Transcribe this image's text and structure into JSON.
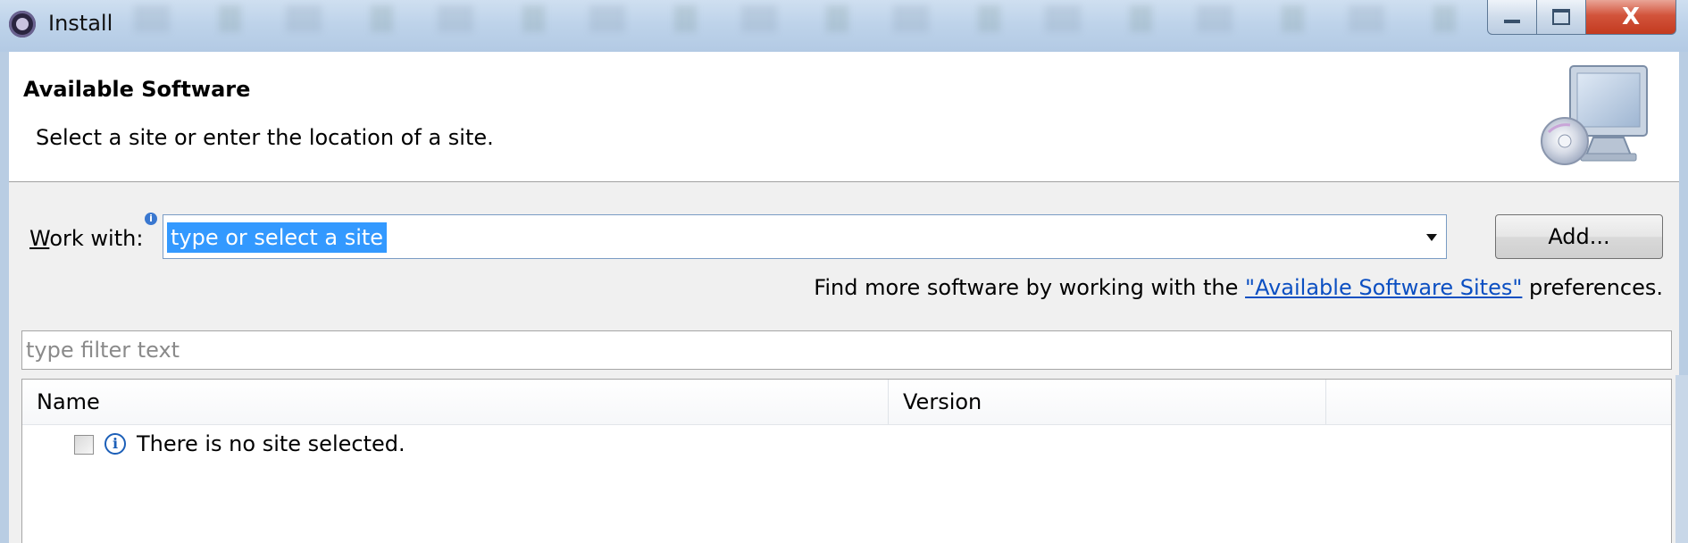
{
  "window": {
    "title": "Install",
    "close_glyph": "X"
  },
  "banner": {
    "title": "Available Software",
    "description": "Select a site or enter the location of a site.",
    "image_icon": "computer-with-cd-icon"
  },
  "work_with": {
    "label": "Work with:",
    "mnemonic": "W",
    "label_rest": "ork with:",
    "value": "type or select a site",
    "add_button_label": "Add...",
    "info_glyph": "i"
  },
  "more_software": {
    "prefix": "Find more software by working with the ",
    "link": "\"Available Software Sites\"",
    "suffix": " preferences."
  },
  "filter": {
    "placeholder": "type filter text"
  },
  "table": {
    "columns": [
      "Name",
      "Version",
      ""
    ],
    "rows": [
      {
        "checked": false,
        "icon": "info-icon",
        "icon_glyph": "i",
        "text": "There is no site selected."
      }
    ]
  },
  "colors": {
    "selection": "#3399ff",
    "link": "#0b4fc2",
    "close_button": "#c33a1f"
  }
}
